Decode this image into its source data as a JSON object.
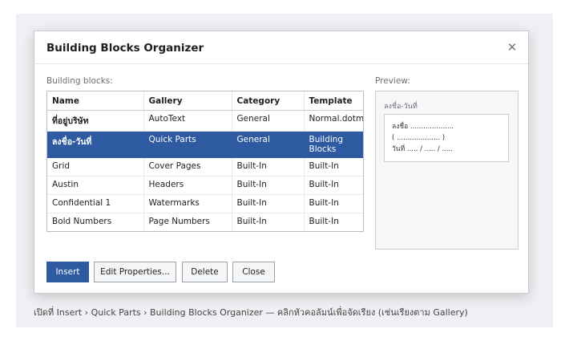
{
  "dialog": {
    "title": "Building Blocks Organizer",
    "close_glyph": "✕"
  },
  "grid": {
    "label": "Building blocks:",
    "columns": [
      "Name",
      "Gallery",
      "Category",
      "Template"
    ],
    "rows": [
      {
        "name": "ที่อยู่บริษัท",
        "gallery": "AutoText",
        "category": "General",
        "template": "Normal.dotm"
      },
      {
        "name": "ลงชื่อ-วันที่",
        "gallery": "Quick Parts",
        "category": "General",
        "template": "Building Blocks"
      },
      {
        "name": "Grid",
        "gallery": "Cover Pages",
        "category": "Built-In",
        "template": "Built-In"
      },
      {
        "name": "Austin",
        "gallery": "Headers",
        "category": "Built-In",
        "template": "Built-In"
      },
      {
        "name": "Confidential 1",
        "gallery": "Watermarks",
        "category": "Built-In",
        "template": "Built-In"
      },
      {
        "name": "Bold Numbers",
        "gallery": "Page Numbers",
        "category": "Built-In",
        "template": "Built-In"
      }
    ],
    "selected_index": 1
  },
  "preview": {
    "label": "Preview:",
    "name": "ลงชื่อ-วันที่",
    "lines": [
      "ลงชื่อ ....................",
      "( .................... )",
      "วันที่ ..... / ..... / ....."
    ]
  },
  "buttons": {
    "insert": "Insert",
    "edit_properties": "Edit Properties...",
    "delete": "Delete",
    "close": "Close"
  },
  "caption": "เปิดที่ Insert › Quick Parts › Building Blocks Organizer — คลิกหัวคอลัมน์เพื่อจัดเรียง (เช่นเรียงตาม Gallery)",
  "colors": {
    "accent": "#2d5aa0"
  }
}
